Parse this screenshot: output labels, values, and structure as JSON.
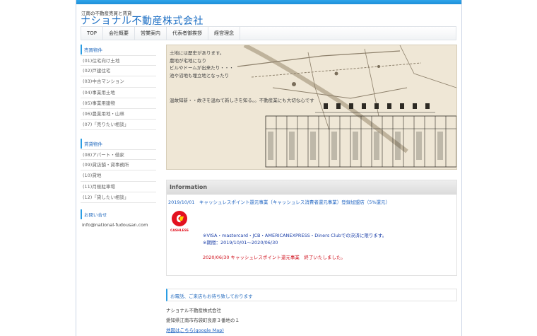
{
  "header": {
    "tagline": "江南の不動産売買と賃貸",
    "company_name": "ナショナル不動産株式会社"
  },
  "nav": {
    "items": [
      "TOP",
      "会社概要",
      "営業案内",
      "代表者御挨拶",
      "経営理念"
    ]
  },
  "sidebar": {
    "sale": {
      "heading": "売買物件",
      "items": [
        "(01)住宅向け土地",
        "(02)戸建住宅",
        "(03)中古マンション",
        "(04)事業用土地",
        "(05)事業用建物",
        "(06)農業用地・山林",
        "(07)「売りたい相談」"
      ]
    },
    "rent": {
      "heading": "賃貸物件",
      "items": [
        "(08)アパート・借家",
        "(09)貸店舗・貸事務所",
        "(10)貸地",
        "(11)月極駐車場",
        "(12)「貸したい相談」"
      ]
    },
    "contact": {
      "heading": "お問い合せ",
      "email": "info@national-fudousan.com"
    }
  },
  "hero": {
    "lines": [
      "土地には歴史があります。",
      "農地が宅地になり",
      "ビルやドームが出来たり・・・",
      "池や沼地も埋立地となったり"
    ],
    "motto": "温故知新・・故きを温ねて新しきを知る。。不動産業にも大切な心です"
  },
  "info": {
    "heading": "Information",
    "news_title": "2019/10/01　キャッシュレスポイント還元事業（キャッシュレス消費者還元事業）登録加盟店（5%還元）",
    "badge_text": "CASHLESS",
    "note_cards": "※VISA・mastercard・JCB・AMERICANEXPRESS・Diners Clubでの決済に限ります。",
    "note_period": "※期間：2019/10/01～2020/06/30",
    "note_end": "2020/06/30 キャッシュレスポイント還元事業　終了いたしました。"
  },
  "contact": {
    "banner": "お電話、ご来店もお待ち致しております",
    "company": "ナショナル不動産株式会社",
    "address": "愛知県江南市布袋町良原３番地の１",
    "map_link": "地図はこちら(google Map)"
  },
  "colors": {
    "accent": "#1d6fc4",
    "topbar": "#2fa5ea",
    "notice_red": "#d0101c"
  }
}
